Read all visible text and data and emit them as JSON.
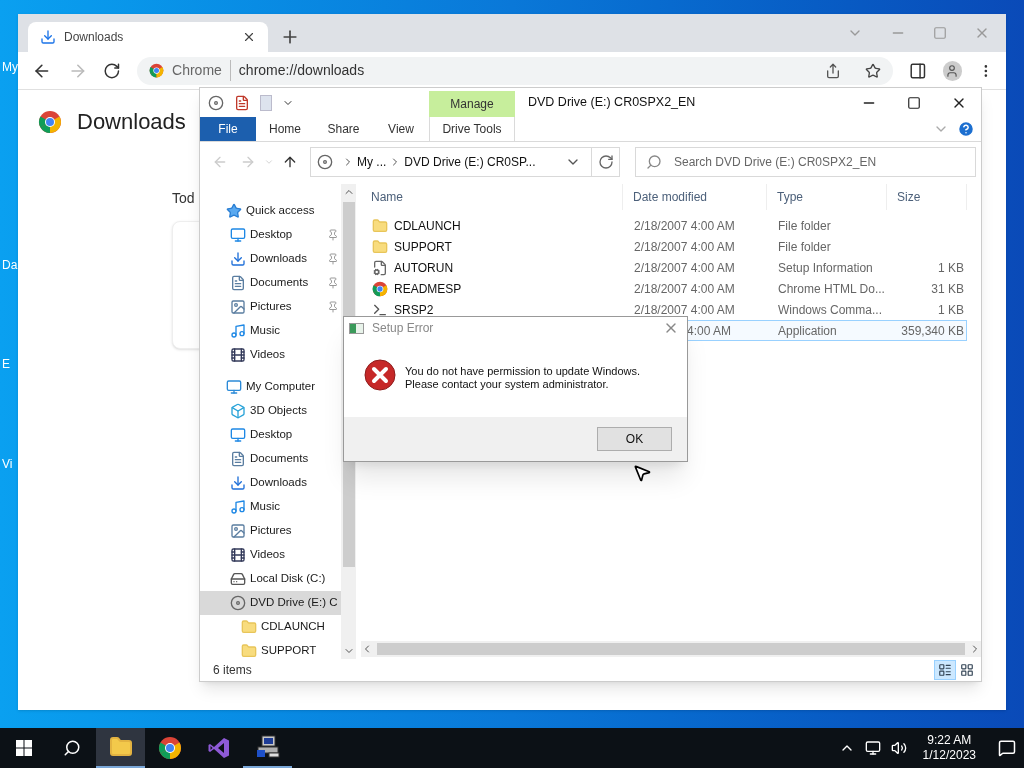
{
  "desktop_icons": [
    {
      "label": "My"
    },
    {
      "label": "Da"
    },
    {
      "label": "E"
    },
    {
      "label": "Vi"
    }
  ],
  "browser": {
    "tabs": [
      {
        "label": "Downloads",
        "selected": true
      }
    ],
    "address": {
      "origin": "Chrome",
      "url": "chrome://downloads"
    },
    "page_title": "Downloads",
    "section_heading": "Tod"
  },
  "explorer": {
    "context_tab": "Manage",
    "title": "DVD Drive (E:) CR0SPX2_EN",
    "ribbon_tabs": [
      {
        "label": "File",
        "kind": "file"
      },
      {
        "label": "Home",
        "kind": "tab"
      },
      {
        "label": "Share",
        "kind": "tab"
      },
      {
        "label": "View",
        "kind": "tab"
      },
      {
        "label": "Drive Tools",
        "kind": "context"
      }
    ],
    "breadcrumb": [
      "My ...",
      "DVD Drive (E:) CR0SP..."
    ],
    "search": {
      "placeholder": "Search DVD Drive (E:) CR0SPX2_EN"
    },
    "nav_pane": [
      {
        "label": "Quick access",
        "kind": "quick",
        "selected": false,
        "children": [
          {
            "label": "Desktop",
            "kind": "desktop",
            "pinned": true,
            "selected": false
          },
          {
            "label": "Downloads",
            "kind": "downloads",
            "pinned": true,
            "selected": false
          },
          {
            "label": "Documents",
            "kind": "documents",
            "pinned": true,
            "selected": false
          },
          {
            "label": "Pictures",
            "kind": "pictures",
            "pinned": true,
            "selected": false
          },
          {
            "label": "Music",
            "kind": "music",
            "pinned": false,
            "selected": false
          },
          {
            "label": "Videos",
            "kind": "videos",
            "pinned": false,
            "selected": false
          }
        ]
      },
      {
        "label": "My Computer",
        "kind": "computer",
        "selected": false,
        "children": [
          {
            "label": "3D Objects",
            "kind": "objects",
            "pinned": false,
            "selected": false
          },
          {
            "label": "Desktop",
            "kind": "desktop",
            "pinned": false,
            "selected": false
          },
          {
            "label": "Documents",
            "kind": "documents",
            "pinned": false,
            "selected": false
          },
          {
            "label": "Downloads",
            "kind": "downloads",
            "pinned": false,
            "selected": false
          },
          {
            "label": "Music",
            "kind": "music",
            "pinned": false,
            "selected": false
          },
          {
            "label": "Pictures",
            "kind": "pictures",
            "pinned": false,
            "selected": false
          },
          {
            "label": "Videos",
            "kind": "videos",
            "pinned": false,
            "selected": false
          },
          {
            "label": "Local Disk (C:)",
            "kind": "disk",
            "pinned": false,
            "selected": false
          },
          {
            "label": "DVD Drive (E:) C",
            "kind": "dvd",
            "pinned": false,
            "selected": true,
            "children": [
              {
                "label": "CDLAUNCH",
                "kind": "folder",
                "pinned": false,
                "selected": false
              },
              {
                "label": "SUPPORT",
                "kind": "folder",
                "pinned": false,
                "selected": false
              }
            ]
          }
        ]
      }
    ],
    "columns": [
      "Name",
      "Date modified",
      "Type",
      "Size"
    ],
    "files": [
      {
        "kind": "folder",
        "name": "CDLAUNCH",
        "date": "2/18/2007 4:00 AM",
        "type": "File folder",
        "selected": false
      },
      {
        "kind": "folder",
        "name": "SUPPORT",
        "date": "2/18/2007 4:00 AM",
        "type": "File folder",
        "selected": false
      },
      {
        "kind": "setup",
        "name": "AUTORUN",
        "date": "2/18/2007 4:00 AM",
        "type": "Setup Information",
        "size": "1 KB",
        "selected": false
      },
      {
        "kind": "html",
        "name": "READMESP",
        "date": "2/18/2007 4:00 AM",
        "type": "Chrome HTML Do...",
        "size": "31 KB",
        "selected": false
      },
      {
        "kind": "cmd",
        "name": "SRSP2",
        "date": "2/18/2007 4:00 AM",
        "type": "Windows Comma...",
        "size": "1 KB",
        "selected": false
      },
      {
        "kind": "covered",
        "date": "4:00 AM",
        "type": "Application",
        "size": "359,340 KB",
        "selected": true
      }
    ],
    "status": "6 items",
    "views": [
      {
        "kind": "details",
        "selected": true
      },
      {
        "kind": "tiles",
        "selected": false
      }
    ]
  },
  "dialog": {
    "title": "Setup Error",
    "message": [
      "You do not have permission to update Windows.",
      "Please contact your system administrator."
    ],
    "buttons": [
      "OK"
    ]
  },
  "taskbar": {
    "apps": [
      {
        "kind": "explorer",
        "active": true
      },
      {
        "kind": "chrome",
        "active": false
      },
      {
        "kind": "studio",
        "active": false
      },
      {
        "kind": "setup",
        "active": true
      }
    ],
    "time": "9:22 AM",
    "date": "1/12/2023"
  }
}
